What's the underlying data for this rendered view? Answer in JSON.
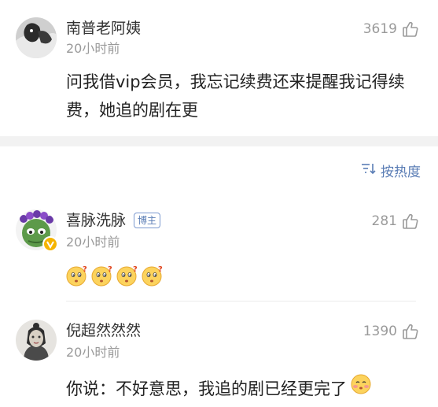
{
  "comments": [
    {
      "user": "南普老阿姨",
      "time": "20小时前",
      "likes": "3619",
      "text": "问我借vip会员，我忘记续费还来提醒我记得续费，她追的剧在更"
    },
    {
      "user": "喜脉洗脉",
      "badge": "博主",
      "time": "20小时前",
      "likes": "281",
      "emojis": [
        "thinking-face-icon",
        "thinking-face-icon",
        "thinking-face-icon",
        "thinking-face-icon"
      ]
    },
    {
      "user": "倪超然然然",
      "time": "20小时前",
      "likes": "1390",
      "text": "你说：不好意思，我追的剧已经更完了"
    }
  ],
  "sort": {
    "label": "按热度",
    "icon": "sort-icon"
  },
  "colors": {
    "link_blue": "#5a7db5",
    "meta_gray": "#9a9a9a",
    "separator": "#f2f2f2"
  }
}
